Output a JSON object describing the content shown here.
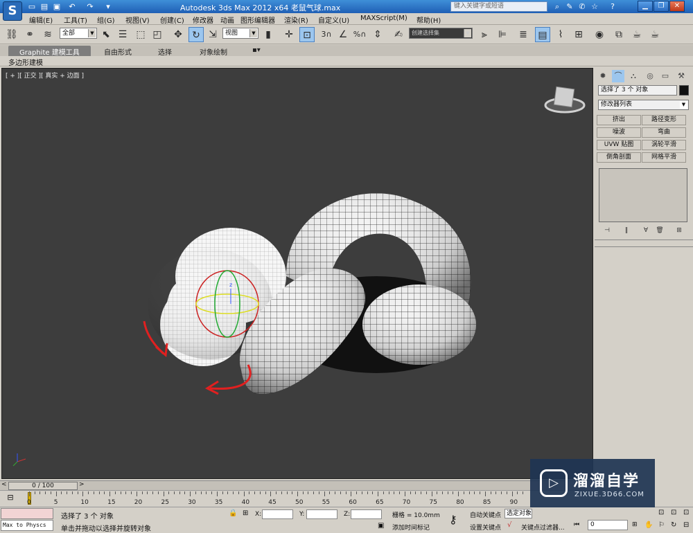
{
  "window": {
    "title": "Autodesk 3ds Max  2012 x64       老鼠气球.max",
    "search_placeholder": "键入关键字或短语",
    "logo_letter": "S"
  },
  "menubar": {
    "items": [
      "编辑(E)",
      "工具(T)",
      "组(G)",
      "视图(V)",
      "创建(C)",
      "修改器",
      "动画",
      "图形编辑器",
      "渲染(R)",
      "自定义(U)",
      "MAXScript(M)",
      "帮助(H)"
    ]
  },
  "toolbar": {
    "selection_filter": "全部",
    "ref_coord": "视图",
    "named_selection": "创建选择集",
    "snap_label": "3",
    "percent_label": "%"
  },
  "ribbon": {
    "tabs": [
      "Graphite 建模工具",
      "自由形式",
      "选择",
      "对象绘制"
    ],
    "sub_label": "多边形建模"
  },
  "viewport": {
    "label": "[ + ][ 正交 ][ 真实 + 边面 ]",
    "background": "#3d3d3d",
    "gizmo_axis_label": "z"
  },
  "command_panel": {
    "selection_text": "选择了 3 个 对象",
    "modifier_list": "修改器列表",
    "buttons": [
      "挤出",
      "路径变形",
      "噪波",
      "弯曲",
      "UVW 贴图",
      "涡轮平滑",
      "倒角剖面",
      "网格平滑"
    ]
  },
  "timeline": {
    "frame_display": "0 / 100",
    "ticks": [
      "0",
      "5",
      "10",
      "15",
      "20",
      "25",
      "30",
      "35",
      "40",
      "45",
      "50",
      "55",
      "60",
      "65",
      "70",
      "75",
      "80",
      "85",
      "90"
    ]
  },
  "status": {
    "script_box": "Max to Physcs (",
    "selected_text": "选择了 3 个 对象",
    "prompt_text": "单击并拖动以选择并旋转对象",
    "x_label": "X:",
    "y_label": "Y:",
    "z_label": "Z:",
    "grid_text": "栅格 = 10.0mm",
    "add_time_tag": "添加时间标记",
    "auto_key": "自动关键点",
    "set_key": "设置关键点",
    "selected_object": "选定对象",
    "key_filters": "关键点过滤器...",
    "frame_input": "0"
  },
  "watermark": {
    "title": "溜溜自学",
    "url": "ZIXUE.3D66.COM"
  },
  "colors": {
    "titlebar": "#1f5fb5",
    "viewport_bg": "#3d3d3d",
    "arrow_red": "#e02020",
    "watermark_bg": "#1e3452"
  }
}
